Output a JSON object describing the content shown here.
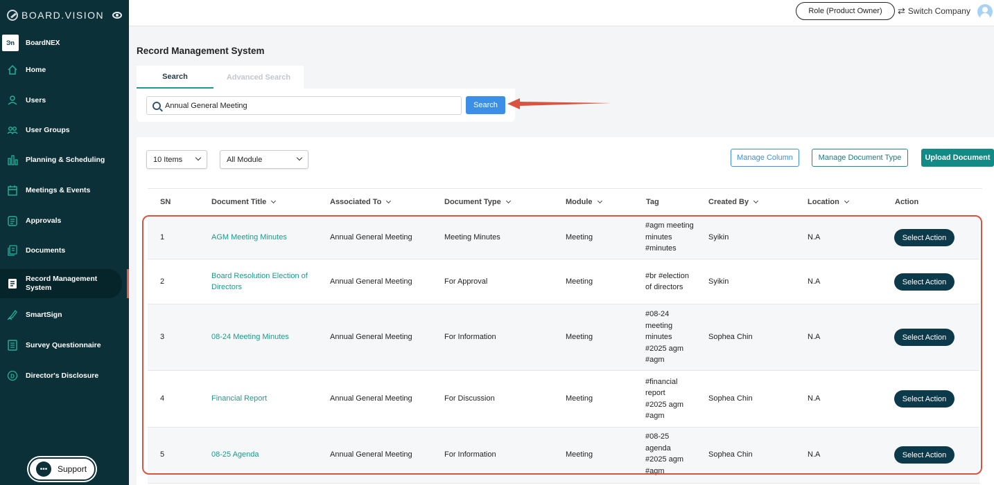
{
  "sidebar": {
    "logo": "BOARD.VISION",
    "company": {
      "logo_text": "Ͽn",
      "name": "BoardNEX"
    },
    "items": [
      {
        "label": "Home",
        "icon": "home-icon"
      },
      {
        "label": "Users",
        "icon": "user-icon"
      },
      {
        "label": "User Groups",
        "icon": "user-group-icon"
      },
      {
        "label": "Planning & Scheduling",
        "icon": "bar-chart-icon"
      },
      {
        "label": "Meetings & Events",
        "icon": "calendar-icon"
      },
      {
        "label": "Approvals",
        "icon": "approval-icon"
      },
      {
        "label": "Documents",
        "icon": "documents-icon"
      },
      {
        "label": "Record Management System",
        "icon": "record-icon",
        "active": true
      },
      {
        "label": "SmartSign",
        "icon": "signature-icon"
      },
      {
        "label": "Survey Questionnaire",
        "icon": "survey-icon"
      },
      {
        "label": "Director's Disclosure",
        "icon": "disclosure-icon"
      }
    ],
    "support_label": "Support"
  },
  "topbar": {
    "role_label": "Role (Product Owner)",
    "switch_label": "Switch Company"
  },
  "page_title": "Record Management System",
  "tabs": {
    "search": "Search",
    "advanced": "Advanced Search"
  },
  "search": {
    "value": "Annual General Meeting",
    "button": "Search"
  },
  "toolbar": {
    "items_select": "10 Items",
    "module_select": "All Module",
    "manage_column": "Manage Column",
    "manage_doctype": "Manage Document Type",
    "upload": "Upload Document"
  },
  "table": {
    "headers": {
      "sn": "SN",
      "title": "Document Title",
      "assoc": "Associated To",
      "type": "Document Type",
      "module": "Module",
      "tag": "Tag",
      "created": "Created By",
      "location": "Location",
      "action": "Action"
    },
    "rows": [
      {
        "sn": "1",
        "title": "AGM Meeting Minutes",
        "assoc": "Annual General Meeting",
        "type": "Meeting Minutes",
        "module": "Meeting",
        "tag": "#agm meeting minutes #minutes",
        "created": "Syikin",
        "location": "N.A",
        "action": "Select Action"
      },
      {
        "sn": "2",
        "title": "Board Resolution Election of Directors",
        "assoc": "Annual General Meeting",
        "type": "For Approval",
        "module": "Meeting",
        "tag": "#br #election of directors",
        "created": "Syikin",
        "location": "N.A",
        "action": "Select Action"
      },
      {
        "sn": "3",
        "title": "08-24 Meeting Minutes",
        "assoc": "Annual General Meeting",
        "type": "For Information",
        "module": "Meeting",
        "tag": "#08-24 meeting minutes #2025 agm #agm",
        "created": "Sophea Chin",
        "location": "N.A",
        "action": "Select Action"
      },
      {
        "sn": "4",
        "title": "Financial Report",
        "assoc": "Annual General Meeting",
        "type": "For Discussion",
        "module": "Meeting",
        "tag": "#financial report #2025 agm #agm",
        "created": "Sophea Chin",
        "location": "N.A",
        "action": "Select Action"
      },
      {
        "sn": "5",
        "title": "08-25 Agenda",
        "assoc": "Annual General Meeting",
        "type": "For Information",
        "module": "Meeting",
        "tag": "#08-25 agenda #2025 agm #agm",
        "created": "Sophea Chin",
        "location": "N.A",
        "action": "Select Action"
      }
    ]
  },
  "colors": {
    "sidebar": "#0c3038",
    "accent": "#1a9a8a",
    "primary_button": "#3b8fe6",
    "highlight": "#d9533f"
  }
}
